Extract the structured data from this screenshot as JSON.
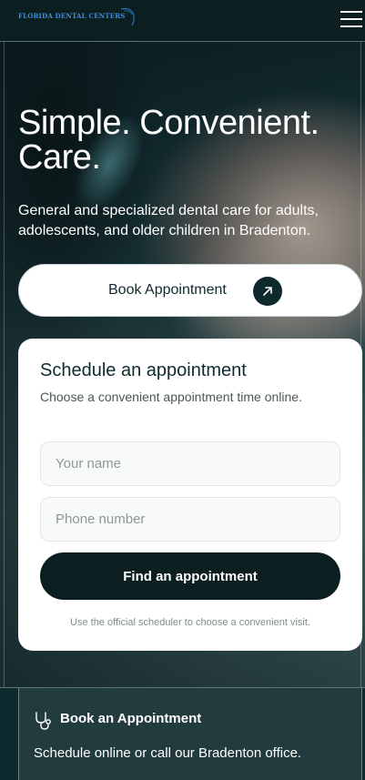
{
  "header": {
    "logo_text": "FLORIDA DENTAL CENTERS",
    "menu_icon": "hamburger-menu-icon"
  },
  "hero": {
    "title_line1": "Simple. Convenient.",
    "title_line2": "Care.",
    "subtitle": "General and specialized dental care for adults, adolescents, and older children in Bradenton.",
    "book_button_label": "Book Appointment",
    "book_button_icon": "arrow-up-right-icon"
  },
  "schedule_card": {
    "title": "Schedule an appointment",
    "description": "Choose a convenient appointment time online.",
    "name_placeholder": "Your name",
    "phone_placeholder": "Phone number",
    "submit_label": "Find an appointment",
    "note": "Use the official scheduler to choose a convenient visit."
  },
  "info_box": {
    "icon": "stethoscope-icon",
    "title": "Book an Appointment",
    "text": "Schedule online or call our Bradenton office."
  },
  "colors": {
    "brand_dark": "#0f2a2e",
    "logo_blue": "#3f8fd8",
    "card_bg": "#ffffff"
  }
}
